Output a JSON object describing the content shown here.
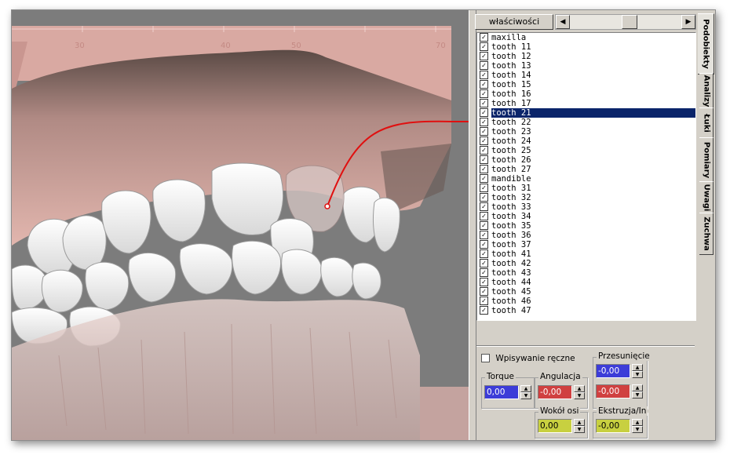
{
  "toolbar": {
    "properties_label": "właściwości"
  },
  "tree": {
    "items": [
      {
        "label": "maxilla",
        "checked": true
      },
      {
        "label": "tooth 11",
        "checked": true
      },
      {
        "label": "tooth 12",
        "checked": true
      },
      {
        "label": "tooth 13",
        "checked": true
      },
      {
        "label": "tooth 14",
        "checked": true
      },
      {
        "label": "tooth 15",
        "checked": true
      },
      {
        "label": "tooth 16",
        "checked": true
      },
      {
        "label": "tooth 17",
        "checked": true
      },
      {
        "label": "tooth 21",
        "checked": true,
        "selected": true
      },
      {
        "label": "tooth 22",
        "checked": true
      },
      {
        "label": "tooth 23",
        "checked": true
      },
      {
        "label": "tooth 24",
        "checked": true
      },
      {
        "label": "tooth 25",
        "checked": true
      },
      {
        "label": "tooth 26",
        "checked": true
      },
      {
        "label": "tooth 27",
        "checked": true
      },
      {
        "label": "mandible",
        "checked": true
      },
      {
        "label": "tooth 31",
        "checked": true
      },
      {
        "label": "tooth 32",
        "checked": true
      },
      {
        "label": "tooth 33",
        "checked": true
      },
      {
        "label": "tooth 34",
        "checked": true
      },
      {
        "label": "tooth 35",
        "checked": true
      },
      {
        "label": "tooth 36",
        "checked": true
      },
      {
        "label": "tooth 37",
        "checked": true
      },
      {
        "label": "tooth 41",
        "checked": true
      },
      {
        "label": "tooth 42",
        "checked": true
      },
      {
        "label": "tooth 43",
        "checked": true
      },
      {
        "label": "tooth 44",
        "checked": true
      },
      {
        "label": "tooth 45",
        "checked": true
      },
      {
        "label": "tooth 46",
        "checked": true
      },
      {
        "label": "tooth 47",
        "checked": true
      }
    ]
  },
  "controls": {
    "manual_entry_label": "Wpisywanie ręczne",
    "torque": {
      "label": "Torque",
      "value": "0,00",
      "color": "#3c3cd8"
    },
    "angulation": {
      "label": "Angulacja",
      "value": "-0,00",
      "color": "#d04040"
    },
    "translation": {
      "label": "Przesunięcie",
      "value_x": "-0,00",
      "value_y": "-0,00",
      "color_x": "#3c3cd8",
      "color_y": "#d04040"
    },
    "rotation": {
      "label": "Wokół osi",
      "value": "0,00",
      "color": "#c8d040"
    },
    "extrusion": {
      "label": "Ekstruzja/In",
      "value": "-0,00",
      "color": "#c8d040"
    }
  },
  "tabs": [
    "Podobiekty",
    "Analizy",
    "Łuki",
    "Pomiary",
    "Uwagi",
    "Zuchwa"
  ],
  "ruler": {
    "ticks": [
      "30",
      "40",
      "50",
      "70"
    ]
  },
  "colors": {
    "selection": "#0a246a",
    "link_curve": "#e01010",
    "gum": "#d6a8a2"
  }
}
